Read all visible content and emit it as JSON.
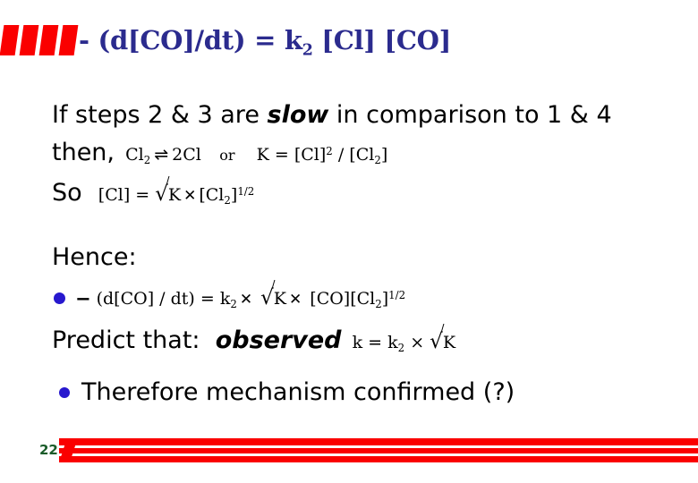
{
  "slide": {
    "page_number": "22",
    "accent_color": "#FA0000",
    "title_color": "#2B2B8E",
    "bullet_color": "#2718CE",
    "page_number_color": "#1A5C2A",
    "background_color": "#FFFFFF"
  },
  "title": {
    "prefix": "- (d[CO]/dt) = k",
    "sub": "2",
    "suffix": " [Cl] [CO]",
    "full_text": "- (d[CO]/dt) = k2 [Cl] [CO]"
  },
  "body": {
    "steps_line": {
      "part1": "If steps 2 & 3 are ",
      "emphasis": "slow",
      "part2": " in comparison to 1 & 4"
    },
    "then_line": {
      "lead": "then,",
      "species_left": "Cl",
      "species_left_sub": "2",
      "arrow": "⇌",
      "species_right": "2Cl",
      "connector": "or",
      "k_expr_lead": "K = [Cl]",
      "k_expr_sup": "2",
      "k_expr_mid": " / [Cl",
      "k_expr_sub": "2",
      "k_expr_end": "]"
    },
    "so_line": {
      "lead": "So",
      "lhs": "[Cl]  =",
      "radical": "√",
      "radicand": "K",
      "times": "✕",
      "rhs_lead": "[Cl",
      "rhs_sub": "2",
      "rhs_mid": "]",
      "rhs_sup": "1/2"
    },
    "hence_label": "Hence:",
    "rate_line": {
      "minus": "−",
      "expr_lead": "(d[CO] / dt)  =  k",
      "k_sub": "2",
      "times1": "✕",
      "radical": "√",
      "radicand": "K",
      "times2": "✕",
      "species_lead": "[CO][Cl",
      "species_sub": "2",
      "species_mid": "]",
      "species_sup": "1/2"
    },
    "predict_line": {
      "lead": "Predict that:",
      "emphasis": "observed",
      "tail_lead": "k  =  k",
      "tail_sub": "2",
      "times": "×",
      "radical": "√",
      "radicand": "K"
    },
    "therefore_line": "Therefore mechanism confirmed (?)"
  }
}
